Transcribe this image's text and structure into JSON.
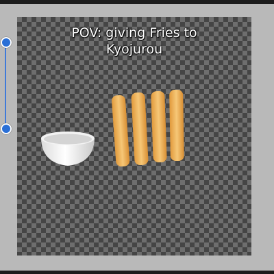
{
  "caption": {
    "line1": "POV: giving Fries to",
    "line2": "Kyojurou"
  },
  "icons": {
    "bowl": "white-bowl-sticker",
    "fries": "french-fries-sticker",
    "handles": "resize-handle"
  },
  "colors": {
    "handle": "#2a6fd6",
    "checker_dark": "#454545",
    "checker_light": "#6e6e6e",
    "surround": "#b9b9b9"
  }
}
